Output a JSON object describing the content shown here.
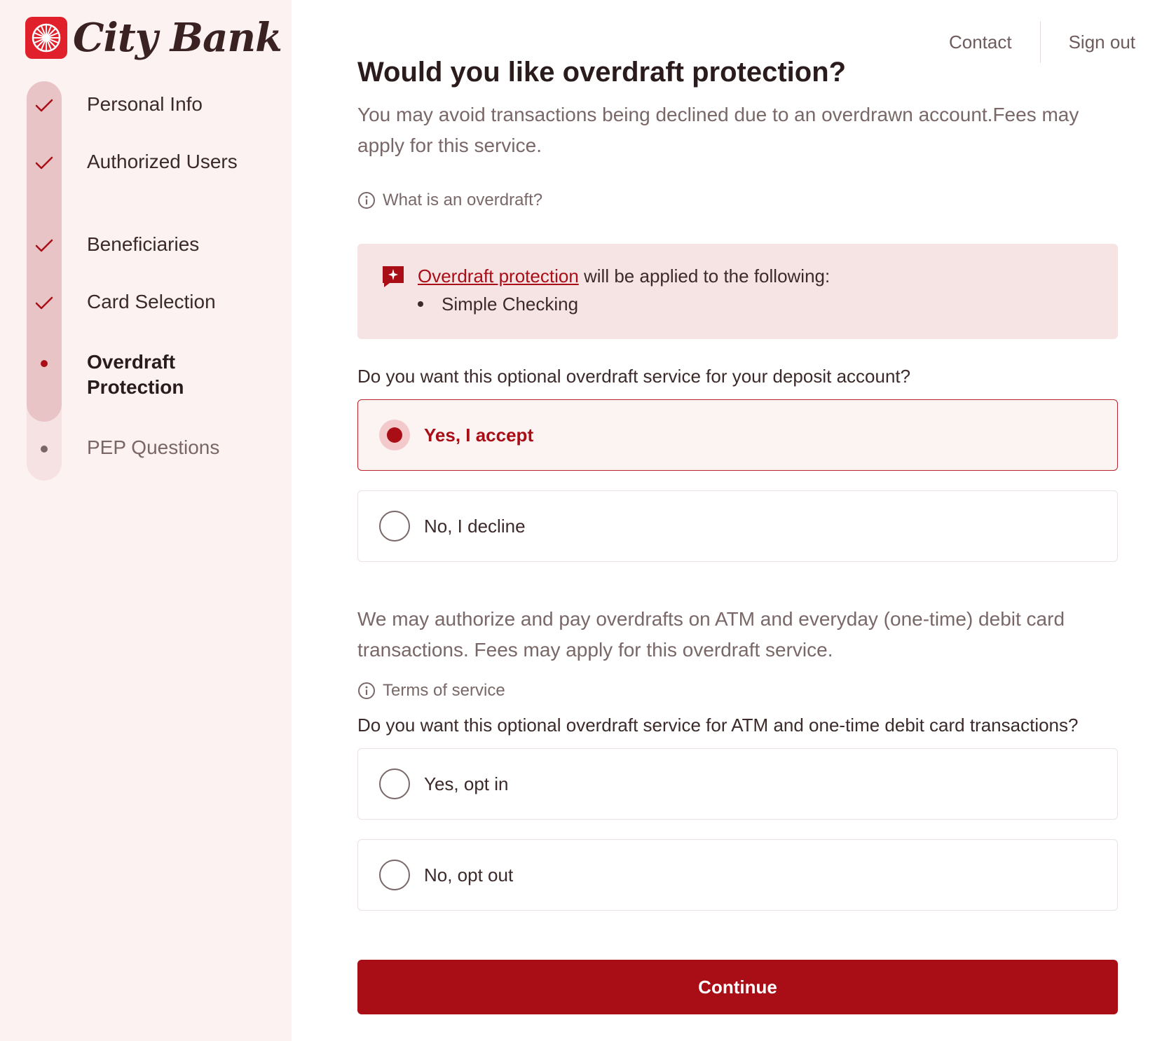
{
  "brand": {
    "name": "City Bank",
    "logo_icon": "wheel-logo-icon",
    "accent": "#a90e17"
  },
  "topnav": {
    "contact": "Contact",
    "sign_out": "Sign out"
  },
  "steps": [
    {
      "label": "Personal Info",
      "status": "complete"
    },
    {
      "label": "Authorized Users",
      "status": "complete"
    },
    {
      "label": "Beneficiaries",
      "status": "complete"
    },
    {
      "label": "Card Selection",
      "status": "complete"
    },
    {
      "label": "Overdraft Protection",
      "status": "current"
    },
    {
      "label": "PEP Questions",
      "status": "pending"
    }
  ],
  "main": {
    "title": "Would you like overdraft protection?",
    "subtitle": "You may avoid transactions being declined due to an overdrawn account.Fees may apply for this service.",
    "overdraft_info_link": "What is an overdraft?",
    "notice": {
      "link_text": "Overdraft protection",
      "text": " will be applied to the following:",
      "accounts": [
        "Simple Checking"
      ]
    },
    "question1": "Do you want this optional overdraft service for your deposit account?",
    "q1_options": [
      {
        "label": "Yes, I accept",
        "selected": true
      },
      {
        "label": "No, I decline",
        "selected": false
      }
    ],
    "paragraph": "We may authorize and pay overdrafts on ATM and everyday (one-time) debit card transactions. Fees may apply for this overdraft service.",
    "terms_link": "Terms of service",
    "question2": "Do you want this optional overdraft service for ATM and one-time debit card transactions?",
    "q2_options": [
      {
        "label": "Yes, opt in",
        "selected": false
      },
      {
        "label": "No, opt out",
        "selected": false
      }
    ],
    "continue_label": "Continue"
  }
}
